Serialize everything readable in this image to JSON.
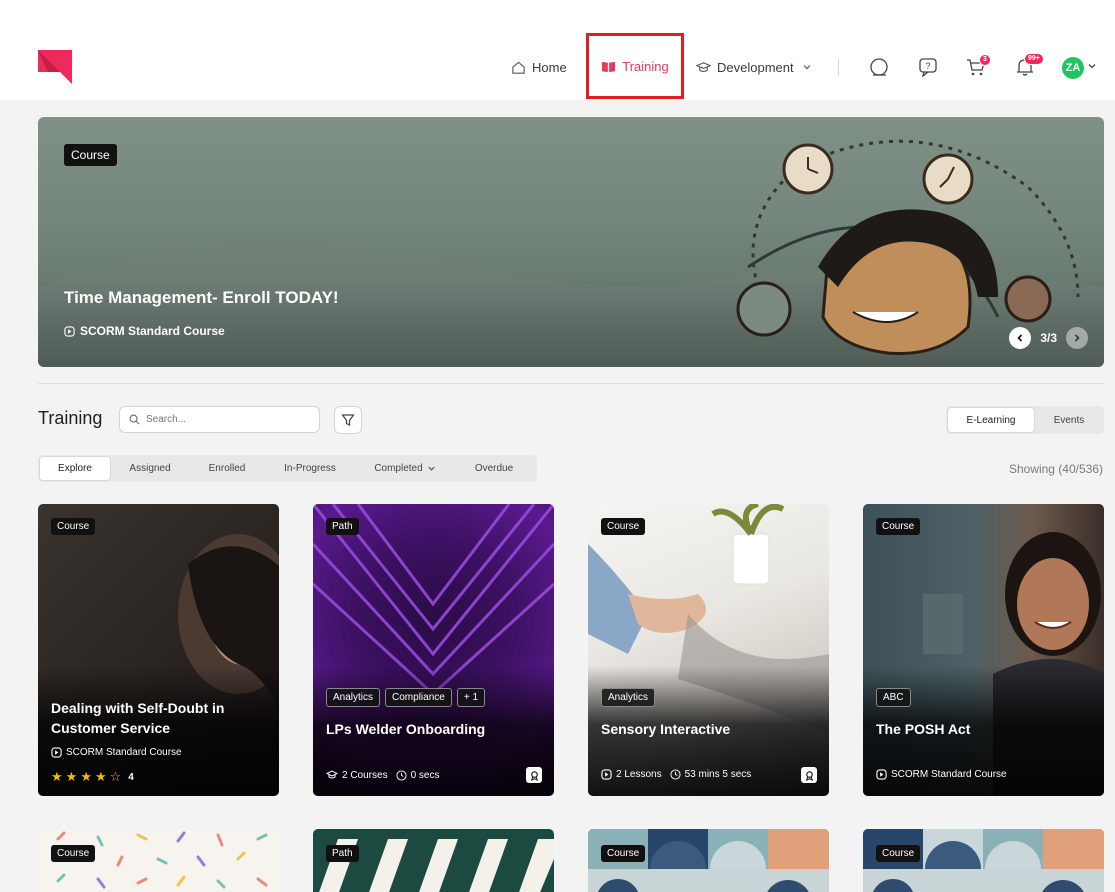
{
  "header": {
    "nav": {
      "home": "Home",
      "training": "Training",
      "development": "Development"
    },
    "badges": {
      "cart": "3",
      "notifications": "99+"
    },
    "avatar_initials": "ZA"
  },
  "hero": {
    "tag": "Course",
    "title": "Time Management- Enroll TODAY!",
    "subtitle": "SCORM Standard Course",
    "pager": "3/3"
  },
  "training": {
    "title": "Training",
    "search_placeholder": "Search...",
    "toggle": [
      "E-Learning",
      "Events"
    ],
    "tabs": [
      "Explore",
      "Assigned",
      "Enrolled",
      "In-Progress",
      "Completed",
      "Overdue"
    ],
    "showing": "Showing (40/536)"
  },
  "cards": [
    {
      "tag": "Course",
      "title": "Dealing with Self-Doubt in Customer Service",
      "meta": "SCORM Standard Course",
      "rating": 4,
      "rating_label": "4"
    },
    {
      "tag": "Path",
      "chips": [
        "Analytics",
        "Compliance",
        "+ 1"
      ],
      "title": "LPs Welder Onboarding",
      "courses": "2 Courses",
      "duration": "0 secs"
    },
    {
      "tag": "Course",
      "chips": [
        "Analytics"
      ],
      "title": "Sensory Interactive",
      "lessons": "2 Lessons",
      "duration": "53 mins 5 secs"
    },
    {
      "tag": "Course",
      "chips": [
        "ABC"
      ],
      "title": "The POSH Act",
      "meta": "SCORM Standard Course"
    }
  ],
  "cards_row2": [
    {
      "tag": "Course"
    },
    {
      "tag": "Path"
    },
    {
      "tag": "Course"
    },
    {
      "tag": "Course"
    }
  ],
  "colors": {
    "brand": "#ee2a5b",
    "highlight_box": "#e02020",
    "avatar": "#22c45d",
    "star": "#f6b800"
  }
}
